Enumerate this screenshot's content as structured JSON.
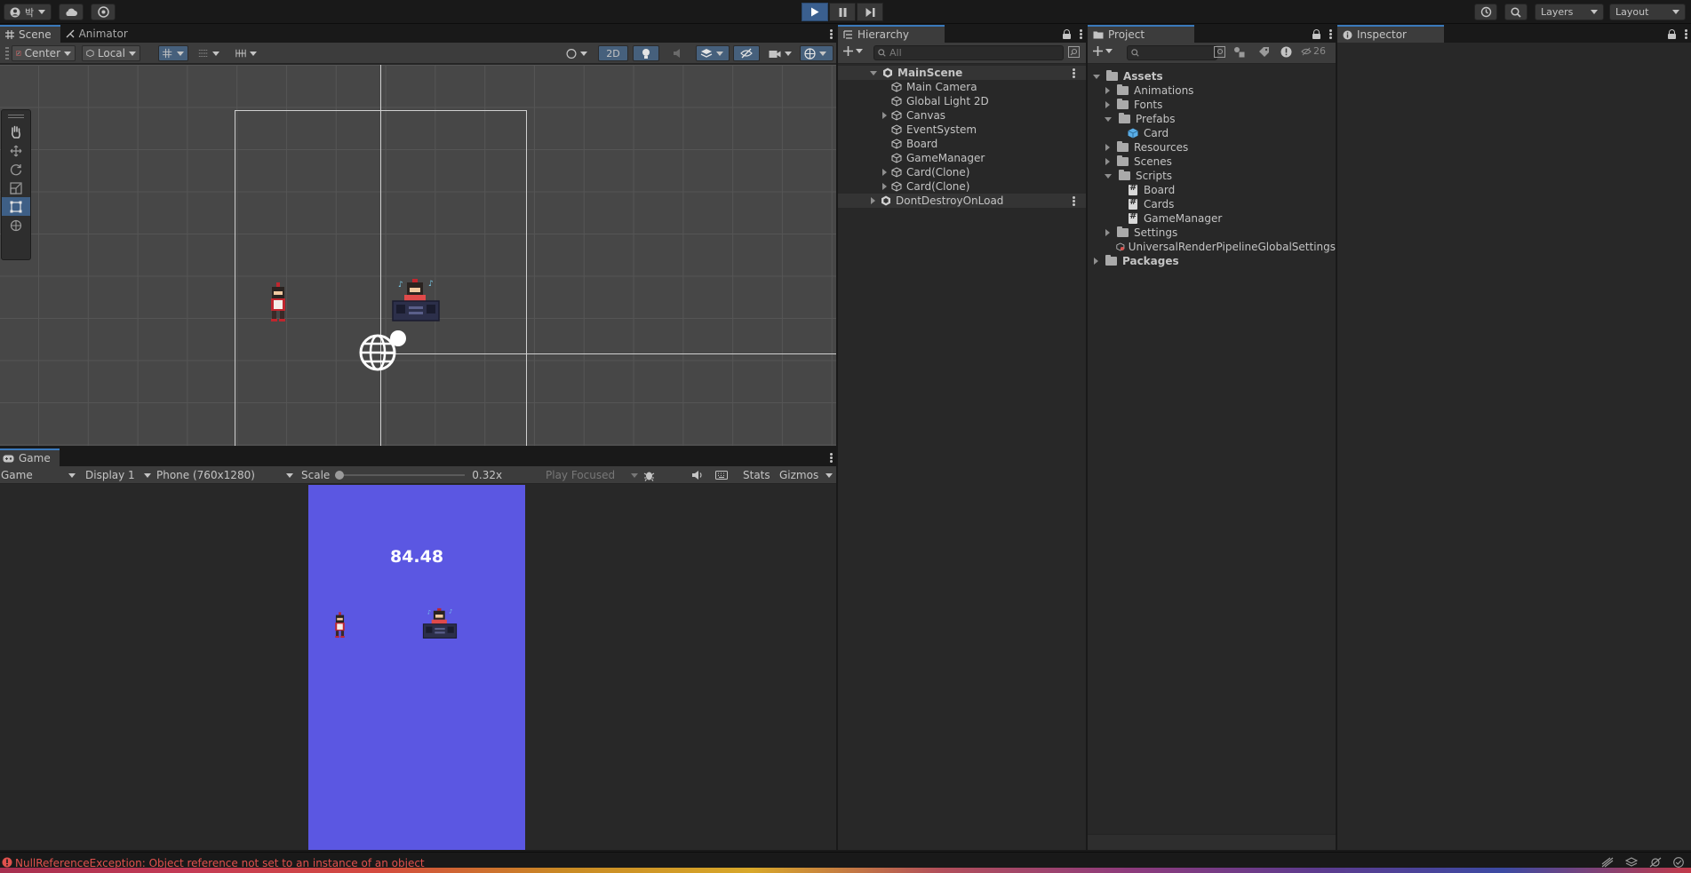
{
  "topbar": {
    "account_label": "박",
    "layers_label": "Layers",
    "layout_label": "Layout"
  },
  "scene_panel": {
    "tabs": [
      {
        "label": "Scene",
        "active": true
      },
      {
        "label": "Animator",
        "active": false
      }
    ],
    "toolbar": {
      "pivot_label": "Center",
      "space_label": "Local",
      "mode_2d_label": "2D"
    }
  },
  "hierarchy": {
    "title": "Hierarchy",
    "search_placeholder": "All",
    "items": [
      {
        "label": "MainScene",
        "kind": "scene",
        "expanded": true
      },
      {
        "label": "Main Camera",
        "kind": "object"
      },
      {
        "label": "Global Light 2D",
        "kind": "object"
      },
      {
        "label": "Canvas",
        "kind": "object",
        "has_children": true
      },
      {
        "label": "EventSystem",
        "kind": "object"
      },
      {
        "label": "Board",
        "kind": "object"
      },
      {
        "label": "GameManager",
        "kind": "object"
      },
      {
        "label": "Card(Clone)",
        "kind": "object",
        "has_children": true
      },
      {
        "label": "Card(Clone)",
        "kind": "object",
        "has_children": true
      },
      {
        "label": "DontDestroyOnLoad",
        "kind": "scene",
        "expanded": false
      }
    ]
  },
  "project": {
    "title": "Project",
    "hidden_count": "26",
    "tree": [
      {
        "label": "Assets",
        "icon": "folder-icon",
        "expanded": true
      },
      {
        "label": "Animations",
        "icon": "folder-icon"
      },
      {
        "label": "Fonts",
        "icon": "folder-icon"
      },
      {
        "label": "Prefabs",
        "icon": "folder-open-icon",
        "expanded": true
      },
      {
        "label": "Card",
        "icon": "prefab-icon"
      },
      {
        "label": "Resources",
        "icon": "folder-icon"
      },
      {
        "label": "Scenes",
        "icon": "folder-icon"
      },
      {
        "label": "Scripts",
        "icon": "folder-open-icon",
        "expanded": true
      },
      {
        "label": "Board",
        "icon": "script-icon"
      },
      {
        "label": "Cards",
        "icon": "script-icon"
      },
      {
        "label": "GameManager",
        "icon": "script-icon"
      },
      {
        "label": "Settings",
        "icon": "folder-icon"
      },
      {
        "label": "UniversalRenderPipelineGlobalSettings",
        "icon": "settings-asset-icon"
      },
      {
        "label": "Packages",
        "icon": "folder-icon"
      }
    ]
  },
  "inspector": {
    "title": "Inspector"
  },
  "game_panel": {
    "tab_label": "Game",
    "toolbar": {
      "view_mode": "Game",
      "display": "Display 1",
      "resolution": "Phone (760x1280)",
      "scale_label": "Scale",
      "scale_value": "0.32x",
      "play_focused": "Play Focused",
      "stats_label": "Stats",
      "gizmos_label": "Gizmos"
    },
    "timer_value": "84.48"
  },
  "statusbar": {
    "error_message": "NullReferenceException: Object reference not set to an instance of an object"
  },
  "colors": {
    "accent": "#3a79bb",
    "game_background": "#5b57e2",
    "error": "#e0514d"
  }
}
